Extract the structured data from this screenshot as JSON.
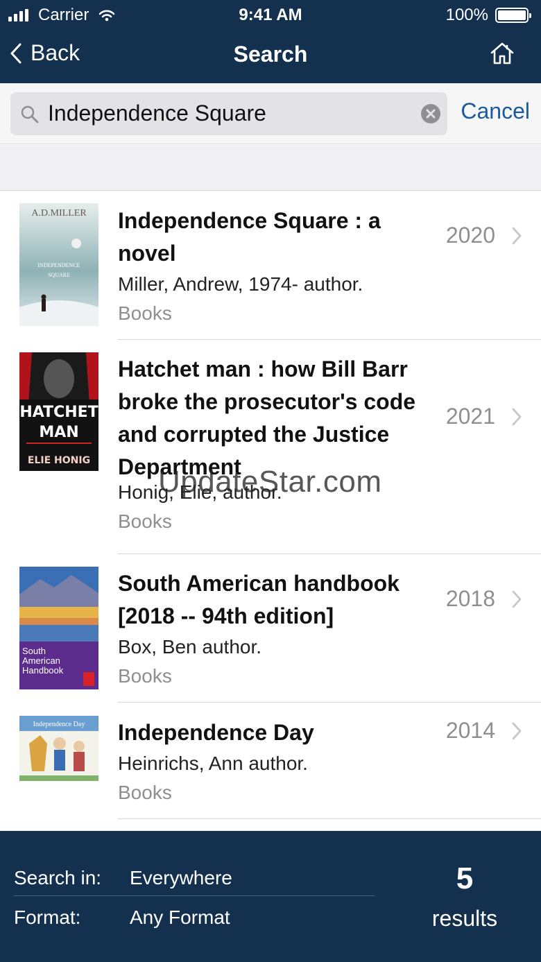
{
  "status_bar": {
    "carrier": "Carrier",
    "time": "9:41 AM",
    "battery": "100%"
  },
  "nav": {
    "back_label": "Back",
    "title": "Search"
  },
  "search": {
    "query": "Independence Square",
    "cancel_label": "Cancel"
  },
  "results": [
    {
      "title": "Independence Square : a novel",
      "title_lines": [
        "Independence Square : a",
        "novel"
      ],
      "author": "Miller, Andrew, 1974- author.",
      "format": "Books",
      "year": "2020",
      "cover": {
        "top_text": "A.D.MILLER",
        "mid_text": "INDEPENDENCE SQUARE",
        "colors": [
          "#cfe0e2",
          "#5f8c93"
        ]
      }
    },
    {
      "title": "Hatchet man : how Bill Barr broke the prosecutor's code and corrupted the Justice Department",
      "title_lines": [
        "Hatchet man : how Bill Barr",
        "broke the prosecutor's code",
        "and corrupted the Justice",
        "Department"
      ],
      "author": "Honig, Elie, author.",
      "format": "Books",
      "year": "2021",
      "cover": {
        "line1": "HATCHET",
        "line2": "MAN",
        "author": "ELIE HONIG",
        "colors": [
          "#b0141a",
          "#111111"
        ]
      }
    },
    {
      "title": "South American handbook [2018 -- 94th edition]",
      "title_lines": [
        "South American handbook",
        "[2018 -- 94th edition]"
      ],
      "author": "Box, Ben author.",
      "format": "Books",
      "year": "2018",
      "cover": {
        "line1": "South",
        "line2": "American",
        "line3": "Handbook",
        "colors": [
          "#3b6fb5",
          "#5b2c8c"
        ]
      }
    },
    {
      "title": "Independence Day",
      "title_lines": [
        "Independence Day"
      ],
      "author": "Heinrichs, Ann author.",
      "format": "Books",
      "year": "2014",
      "cover": {
        "top_text": "Independence Day",
        "colors": [
          "#6a9ed1",
          "#e8efe3"
        ]
      }
    }
  ],
  "watermark": "UpdateStar.com",
  "footer": {
    "search_in_label": "Search in:",
    "search_in_value": "Everywhere",
    "format_label": "Format:",
    "format_value": "Any Format",
    "result_count": "5",
    "result_count_label": "results"
  },
  "colors": {
    "header": "#13304f",
    "accent": "#1a5a9e",
    "secondary_text": "#8e8e93"
  },
  "icons": {
    "back": "chevron-left-icon",
    "home": "home-icon",
    "search": "magnifier-icon",
    "clear": "clear-x-icon",
    "row": "chevron-right-icon"
  }
}
